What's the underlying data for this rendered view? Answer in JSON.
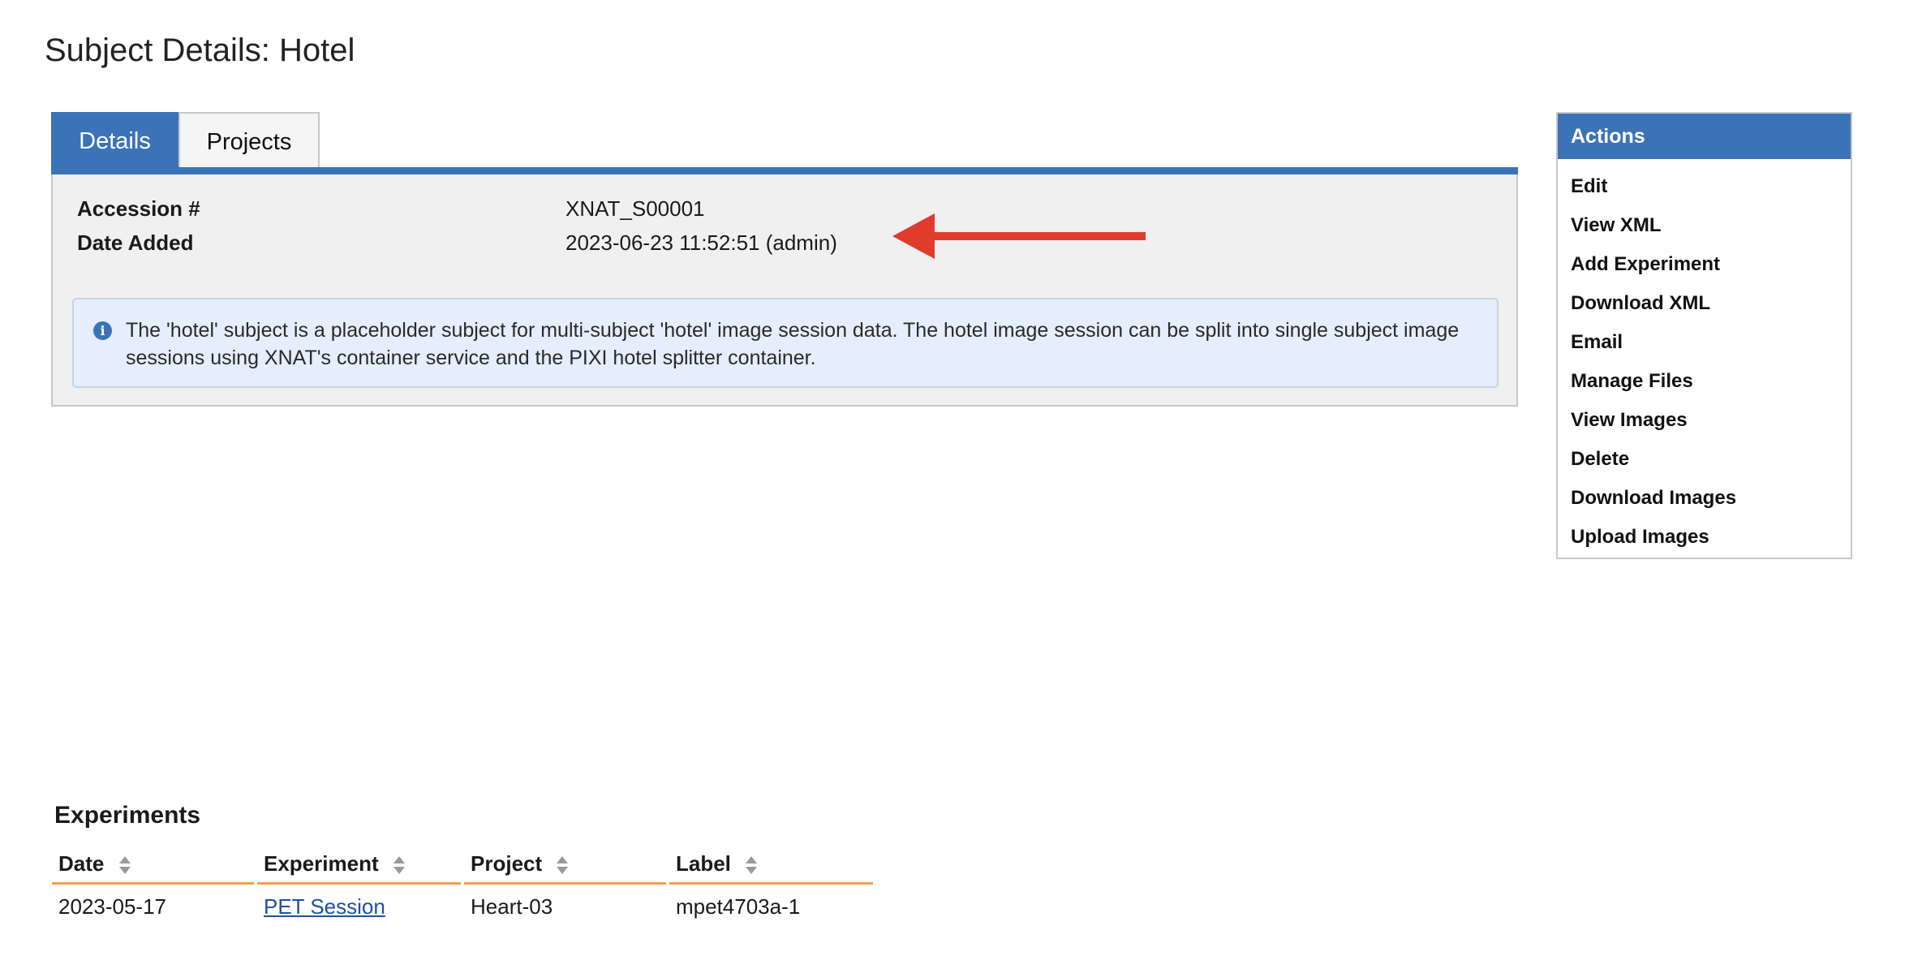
{
  "page": {
    "title": "Subject Details: Hotel"
  },
  "tabs": [
    {
      "label": "Details",
      "active": true
    },
    {
      "label": "Projects",
      "active": false
    }
  ],
  "details": {
    "fields": [
      {
        "label": "Accession #",
        "value": "XNAT_S00001"
      },
      {
        "label": "Date Added",
        "value": "2023-06-23 11:52:51 (admin)"
      }
    ],
    "info_message": "The 'hotel' subject is a placeholder subject for multi-subject 'hotel' image session data. The hotel image session can be split into single subject image sessions using XNAT's container service and the PIXI hotel splitter container.",
    "info_icon": "info-circle-icon"
  },
  "annotation": {
    "arrow_icon": "red-arrow-left-icon",
    "color": "#e03c2c"
  },
  "actions": {
    "header": "Actions",
    "items": [
      "Edit",
      "View XML",
      "Add Experiment",
      "Download XML",
      "Email",
      "Manage Files",
      "View Images",
      "Delete",
      "Download Images",
      "Upload Images"
    ]
  },
  "experiments": {
    "title": "Experiments",
    "columns": [
      "Date",
      "Experiment",
      "Project",
      "Label"
    ],
    "rows": [
      {
        "date": "2023-05-17",
        "experiment": "PET Session",
        "project": "Heart-03",
        "label": "mpet4703a-1"
      }
    ],
    "sort_icon": "sort-arrows-icon"
  },
  "colors": {
    "accent": "#3b73b9",
    "panel_bg": "#f0f0f0",
    "info_bg": "#e4eefc",
    "table_header_underline": "#f0a04b",
    "link": "#1f4fa0"
  }
}
